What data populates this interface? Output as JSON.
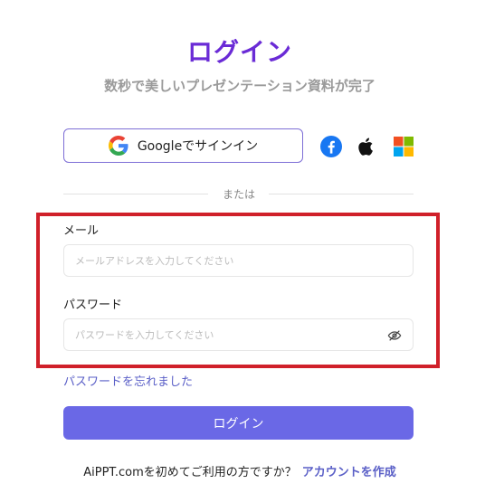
{
  "header": {
    "title": "ログイン",
    "subtitle": "数秒で美しいプレゼンテーション資料が完了"
  },
  "social": {
    "google_label": "Googleでサインイン",
    "icons": [
      "google-icon",
      "facebook-icon",
      "apple-icon",
      "microsoft-icon"
    ]
  },
  "divider": {
    "text": "または"
  },
  "form": {
    "email_label": "メール",
    "email_placeholder": "メールアドレスを入力してください",
    "email_value": "",
    "password_label": "パスワード",
    "password_placeholder": "パスワードを入力してください",
    "password_value": "",
    "forgot_label": "パスワードを忘れました",
    "login_label": "ログイン"
  },
  "footer": {
    "prompt": "AiPPT.comを初めてご利用の方ですか？",
    "create_label": "アカウントを作成"
  },
  "colors": {
    "title": "#6a2bd6",
    "primary_button": "#6a68e6",
    "link": "#5a5fc7",
    "highlight": "#d0202a"
  }
}
